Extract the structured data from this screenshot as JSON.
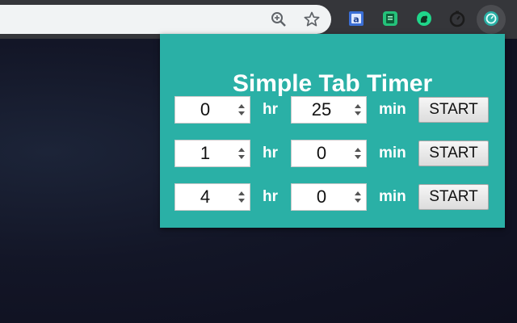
{
  "popup": {
    "title": "Simple Tab Timer",
    "timers": [
      {
        "hours": "0",
        "minutes": "25",
        "hr_label": "hr",
        "min_label": "min",
        "button": "START"
      },
      {
        "hours": "1",
        "minutes": "0",
        "hr_label": "hr",
        "min_label": "min",
        "button": "START"
      },
      {
        "hours": "4",
        "minutes": "0",
        "hr_label": "hr",
        "min_label": "min",
        "button": "START"
      }
    ]
  },
  "toolbar": {
    "omnibox_icons": [
      "zoom-icon",
      "bookmark-star-icon"
    ],
    "extensions": [
      "translate-extension-icon",
      "green-note-extension-icon",
      "green-squirrel-extension-icon",
      "timer-extension-icon",
      "simple-tab-timer-extension-icon"
    ]
  },
  "colors": {
    "popup_background": "#2ab0a6",
    "page_background": "#0f1020",
    "toolbar_background": "#35363a",
    "omnibox_background": "#f1f3f4"
  }
}
